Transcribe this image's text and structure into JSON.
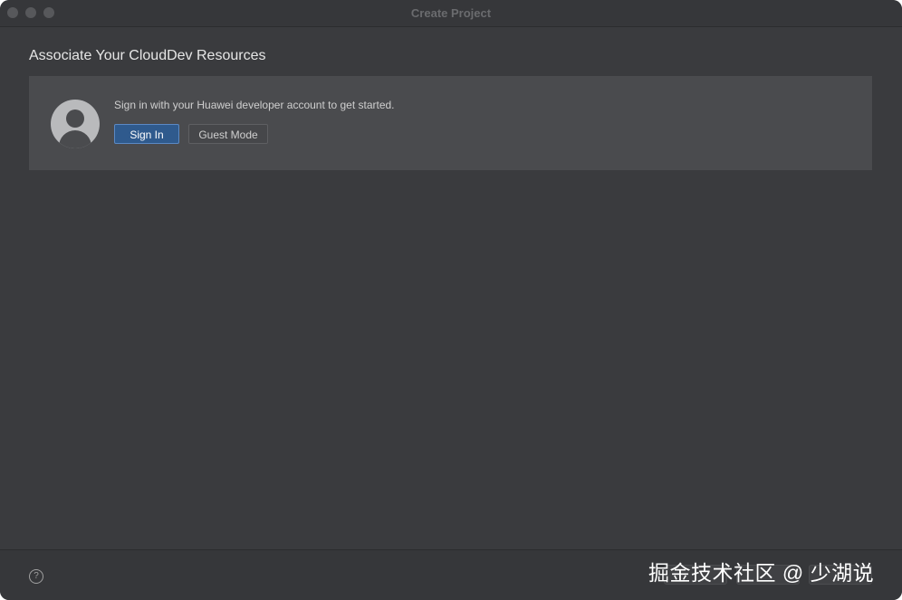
{
  "window": {
    "title": "Create Project"
  },
  "heading": "Associate Your CloudDev Resources",
  "account_panel": {
    "prompt": "Sign in with your Huawei developer account to get started.",
    "sign_in_label": "Sign In",
    "guest_mode_label": "Guest Mode",
    "avatar_icon": "user-avatar-icon"
  },
  "footer": {
    "help_glyph": "?",
    "help_icon": "help-circle-icon"
  },
  "watermark": "掘金技术社区 @ 少湖说",
  "colors": {
    "background": "#3a3b3e",
    "panel": "#4a4b4e",
    "primary_button": "#2f5a8d"
  }
}
